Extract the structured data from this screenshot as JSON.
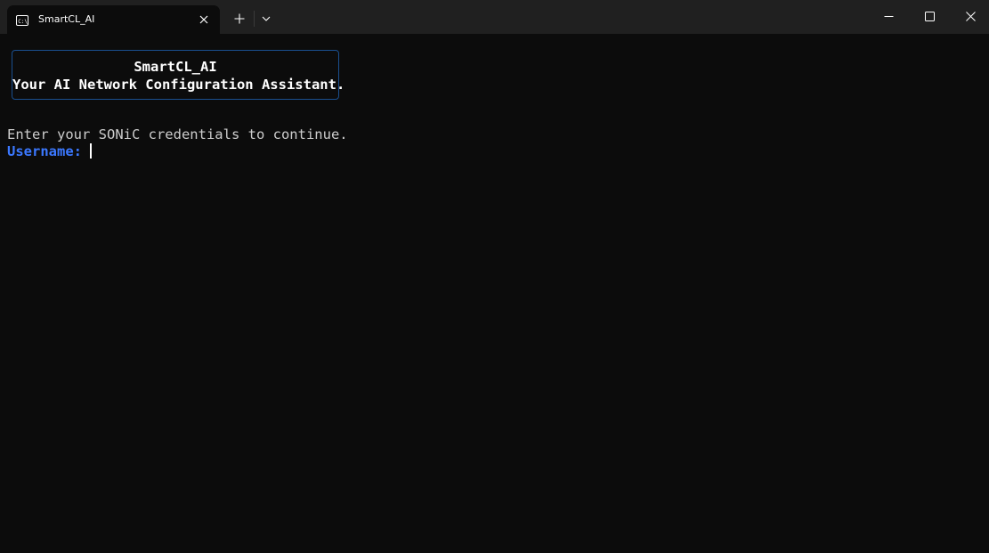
{
  "window": {
    "tab_title": "SmartCL_AI",
    "tab_icon": "terminal-icon",
    "controls": {
      "new_tab_icon": "plus-icon",
      "dropdown_icon": "chevron-down-icon",
      "minimize_icon": "minimize-icon",
      "maximize_icon": "maximize-icon",
      "close_icon": "close-icon"
    }
  },
  "terminal": {
    "banner": {
      "title": "SmartCL_AI",
      "subtitle": "Your AI Network Configuration Assistant."
    },
    "prompt_message": "Enter your SONiC credentials to continue.",
    "username_label": "Username:",
    "username_value": ""
  },
  "colors": {
    "background": "#0c0c0c",
    "titlebar": "#202020",
    "banner_border": "#1a4f8f",
    "label_accent": "#3b78ff",
    "text": "#cccccc"
  }
}
